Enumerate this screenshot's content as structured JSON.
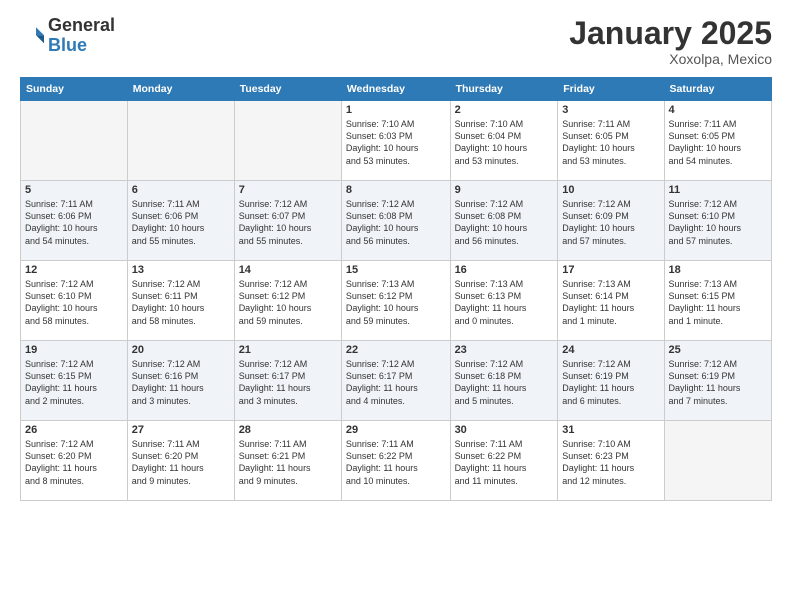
{
  "header": {
    "logo_general": "General",
    "logo_blue": "Blue",
    "title": "January 2025",
    "subtitle": "Xoxolpa, Mexico"
  },
  "calendar": {
    "days_of_week": [
      "Sunday",
      "Monday",
      "Tuesday",
      "Wednesday",
      "Thursday",
      "Friday",
      "Saturday"
    ],
    "weeks": [
      [
        {
          "day": "",
          "info": ""
        },
        {
          "day": "",
          "info": ""
        },
        {
          "day": "",
          "info": ""
        },
        {
          "day": "1",
          "info": "Sunrise: 7:10 AM\nSunset: 6:03 PM\nDaylight: 10 hours\nand 53 minutes."
        },
        {
          "day": "2",
          "info": "Sunrise: 7:10 AM\nSunset: 6:04 PM\nDaylight: 10 hours\nand 53 minutes."
        },
        {
          "day": "3",
          "info": "Sunrise: 7:11 AM\nSunset: 6:05 PM\nDaylight: 10 hours\nand 53 minutes."
        },
        {
          "day": "4",
          "info": "Sunrise: 7:11 AM\nSunset: 6:05 PM\nDaylight: 10 hours\nand 54 minutes."
        }
      ],
      [
        {
          "day": "5",
          "info": "Sunrise: 7:11 AM\nSunset: 6:06 PM\nDaylight: 10 hours\nand 54 minutes."
        },
        {
          "day": "6",
          "info": "Sunrise: 7:11 AM\nSunset: 6:06 PM\nDaylight: 10 hours\nand 55 minutes."
        },
        {
          "day": "7",
          "info": "Sunrise: 7:12 AM\nSunset: 6:07 PM\nDaylight: 10 hours\nand 55 minutes."
        },
        {
          "day": "8",
          "info": "Sunrise: 7:12 AM\nSunset: 6:08 PM\nDaylight: 10 hours\nand 56 minutes."
        },
        {
          "day": "9",
          "info": "Sunrise: 7:12 AM\nSunset: 6:08 PM\nDaylight: 10 hours\nand 56 minutes."
        },
        {
          "day": "10",
          "info": "Sunrise: 7:12 AM\nSunset: 6:09 PM\nDaylight: 10 hours\nand 57 minutes."
        },
        {
          "day": "11",
          "info": "Sunrise: 7:12 AM\nSunset: 6:10 PM\nDaylight: 10 hours\nand 57 minutes."
        }
      ],
      [
        {
          "day": "12",
          "info": "Sunrise: 7:12 AM\nSunset: 6:10 PM\nDaylight: 10 hours\nand 58 minutes."
        },
        {
          "day": "13",
          "info": "Sunrise: 7:12 AM\nSunset: 6:11 PM\nDaylight: 10 hours\nand 58 minutes."
        },
        {
          "day": "14",
          "info": "Sunrise: 7:12 AM\nSunset: 6:12 PM\nDaylight: 10 hours\nand 59 minutes."
        },
        {
          "day": "15",
          "info": "Sunrise: 7:13 AM\nSunset: 6:12 PM\nDaylight: 10 hours\nand 59 minutes."
        },
        {
          "day": "16",
          "info": "Sunrise: 7:13 AM\nSunset: 6:13 PM\nDaylight: 11 hours\nand 0 minutes."
        },
        {
          "day": "17",
          "info": "Sunrise: 7:13 AM\nSunset: 6:14 PM\nDaylight: 11 hours\nand 1 minute."
        },
        {
          "day": "18",
          "info": "Sunrise: 7:13 AM\nSunset: 6:15 PM\nDaylight: 11 hours\nand 1 minute."
        }
      ],
      [
        {
          "day": "19",
          "info": "Sunrise: 7:12 AM\nSunset: 6:15 PM\nDaylight: 11 hours\nand 2 minutes."
        },
        {
          "day": "20",
          "info": "Sunrise: 7:12 AM\nSunset: 6:16 PM\nDaylight: 11 hours\nand 3 minutes."
        },
        {
          "day": "21",
          "info": "Sunrise: 7:12 AM\nSunset: 6:17 PM\nDaylight: 11 hours\nand 3 minutes."
        },
        {
          "day": "22",
          "info": "Sunrise: 7:12 AM\nSunset: 6:17 PM\nDaylight: 11 hours\nand 4 minutes."
        },
        {
          "day": "23",
          "info": "Sunrise: 7:12 AM\nSunset: 6:18 PM\nDaylight: 11 hours\nand 5 minutes."
        },
        {
          "day": "24",
          "info": "Sunrise: 7:12 AM\nSunset: 6:19 PM\nDaylight: 11 hours\nand 6 minutes."
        },
        {
          "day": "25",
          "info": "Sunrise: 7:12 AM\nSunset: 6:19 PM\nDaylight: 11 hours\nand 7 minutes."
        }
      ],
      [
        {
          "day": "26",
          "info": "Sunrise: 7:12 AM\nSunset: 6:20 PM\nDaylight: 11 hours\nand 8 minutes."
        },
        {
          "day": "27",
          "info": "Sunrise: 7:11 AM\nSunset: 6:20 PM\nDaylight: 11 hours\nand 9 minutes."
        },
        {
          "day": "28",
          "info": "Sunrise: 7:11 AM\nSunset: 6:21 PM\nDaylight: 11 hours\nand 9 minutes."
        },
        {
          "day": "29",
          "info": "Sunrise: 7:11 AM\nSunset: 6:22 PM\nDaylight: 11 hours\nand 10 minutes."
        },
        {
          "day": "30",
          "info": "Sunrise: 7:11 AM\nSunset: 6:22 PM\nDaylight: 11 hours\nand 11 minutes."
        },
        {
          "day": "31",
          "info": "Sunrise: 7:10 AM\nSunset: 6:23 PM\nDaylight: 11 hours\nand 12 minutes."
        },
        {
          "day": "",
          "info": ""
        }
      ]
    ]
  }
}
